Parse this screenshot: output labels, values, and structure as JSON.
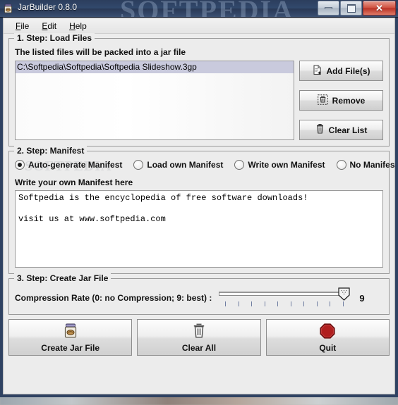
{
  "window": {
    "title": "JarBuilder 0.8.0",
    "app_icon": "jar-icon",
    "watermark": "SOFTPEDIA",
    "controls": {
      "minimize": "minimize",
      "maximize": "maximize",
      "close": "close"
    }
  },
  "menubar": {
    "items": [
      {
        "label": "File",
        "mnemonic": "F"
      },
      {
        "label": "Edit",
        "mnemonic": "E"
      },
      {
        "label": "Help",
        "mnemonic": "H"
      }
    ]
  },
  "step1": {
    "legend": "1. Step: Load Files",
    "description": "The listed files will be packed into a jar file",
    "files": [
      {
        "path": "C:\\Softpedia\\Softpedia\\Softpedia Slideshow.3gp",
        "selected": true
      }
    ],
    "buttons": [
      {
        "label": "Add File(s)",
        "icon": "document-add-icon"
      },
      {
        "label": "Remove",
        "icon": "trash-dashed-icon"
      },
      {
        "label": "Clear List",
        "icon": "trash-icon"
      }
    ]
  },
  "step2": {
    "legend": "2. Step: Manifest",
    "watermark": "SOFTPEDIA",
    "options": [
      {
        "label": "Auto-generate Manifest",
        "selected": true,
        "mnemonic": "g"
      },
      {
        "label": "Load own Manifest",
        "selected": false
      },
      {
        "label": "Write own Manifest",
        "selected": false
      },
      {
        "label": "No Manifest",
        "selected": false
      }
    ],
    "manifest_label": "Write your own Manifest here",
    "manifest_text": "Softpedia is the encyclopedia of free software downloads!\n\nvisit us at www.softpedia.com"
  },
  "step3": {
    "legend": "3. Step: Create Jar File",
    "compression_label": "Compression Rate (0: no Compression; 9: best) :",
    "compression_value": "9",
    "compression_min": 0,
    "compression_max": 9,
    "tick_count": 10
  },
  "actions": [
    {
      "label": "Create Jar File",
      "icon": "jar-icon"
    },
    {
      "label": "Clear All",
      "icon": "trash-icon"
    },
    {
      "label": "Quit",
      "icon": "stop-octagon-icon"
    }
  ],
  "colors": {
    "titlebar": "#31486b",
    "window_border": "#2f4262",
    "panel_bg": "#ececec",
    "selection": "#c9cadd",
    "close_button": "#c4402f",
    "quit_icon": "#a81f1f",
    "tick": "#6f7da1"
  }
}
